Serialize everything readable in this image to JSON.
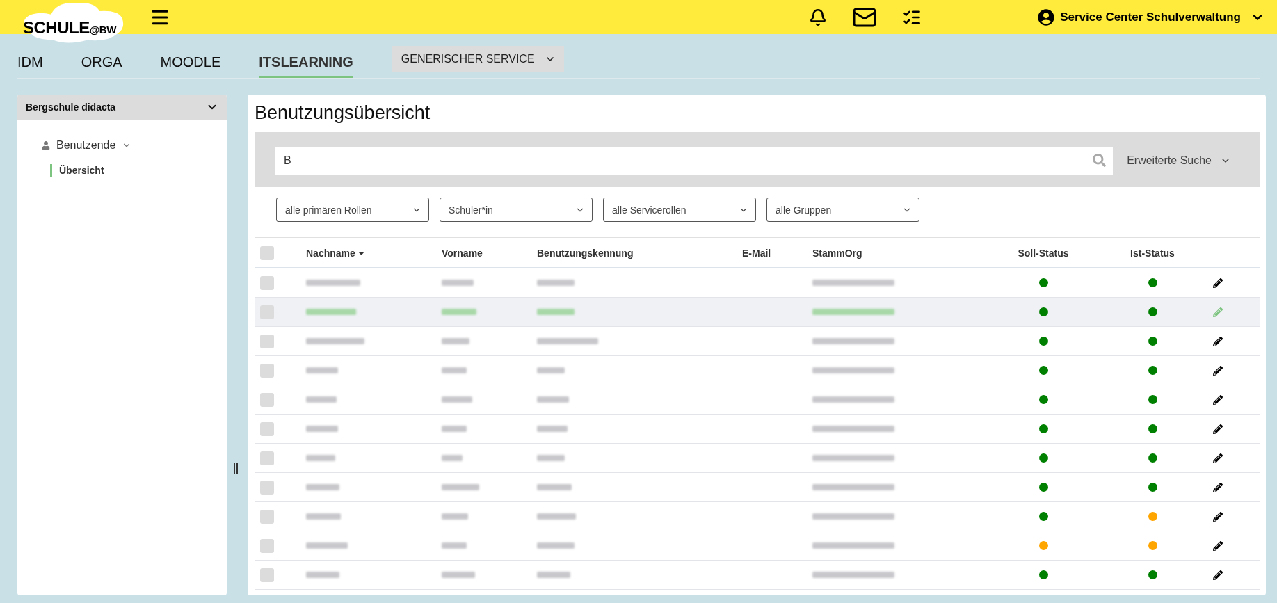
{
  "logo": {
    "main": "SCHULE",
    "suffix": "@BW"
  },
  "header": {
    "user": "Service Center Schulverwaltung"
  },
  "nav": {
    "tabs": [
      {
        "label": "IDM",
        "selected": false
      },
      {
        "label": "ORGA",
        "selected": false
      },
      {
        "label": "MOODLE",
        "selected": false
      },
      {
        "label": "ITSLEARNING",
        "selected": true
      }
    ],
    "service_dropdown": "GENERISCHER SERVICE"
  },
  "sidebar": {
    "school": "Bergschule didacta",
    "items": [
      {
        "label": "Benutzende",
        "expanded": true,
        "children": [
          {
            "label": "Übersicht",
            "selected": true
          }
        ]
      }
    ]
  },
  "main": {
    "title": "Benutzungsübersicht",
    "search": {
      "value": "B",
      "advanced": "Erweiterte Suche"
    },
    "filters": [
      "alle primären Rollen",
      "Schüler*in",
      "alle Servicerollen",
      "alle Gruppen"
    ],
    "table": {
      "select_all": {
        "checked": false
      },
      "columns": [
        {
          "label": "Nachname",
          "sorted": true
        },
        {
          "label": "Vorname",
          "sorted": false
        },
        {
          "label": "Benutzungskennung",
          "sorted": false
        },
        {
          "label": "E-Mail",
          "sorted": false
        },
        {
          "label": "StammOrg",
          "sorted": false
        },
        {
          "label": "Soll-Status",
          "sorted": false
        },
        {
          "label": "Ist-Status",
          "sorted": false
        }
      ],
      "rows": [
        {
          "checked": false,
          "highlighted": false,
          "soll": {
            "color": "#008000"
          },
          "ist": {
            "color": "#008000"
          }
        },
        {
          "checked": false,
          "highlighted": true,
          "soll": {
            "color": "#008000"
          },
          "ist": {
            "color": "#008000"
          }
        },
        {
          "checked": false,
          "highlighted": false,
          "soll": {
            "color": "#008000"
          },
          "ist": {
            "color": "#008000"
          }
        },
        {
          "checked": false,
          "highlighted": false,
          "soll": {
            "color": "#008000"
          },
          "ist": {
            "color": "#008000"
          }
        },
        {
          "checked": false,
          "highlighted": false,
          "soll": {
            "color": "#008000"
          },
          "ist": {
            "color": "#008000"
          }
        },
        {
          "checked": false,
          "highlighted": false,
          "soll": {
            "color": "#008000"
          },
          "ist": {
            "color": "#008000"
          }
        },
        {
          "checked": false,
          "highlighted": false,
          "soll": {
            "color": "#008000"
          },
          "ist": {
            "color": "#008000"
          }
        },
        {
          "checked": false,
          "highlighted": false,
          "soll": {
            "color": "#008000"
          },
          "ist": {
            "color": "#008000"
          }
        },
        {
          "checked": false,
          "highlighted": false,
          "soll": {
            "color": "#008000"
          },
          "ist": {
            "color": "#ffa500"
          }
        },
        {
          "checked": false,
          "highlighted": false,
          "soll": {
            "color": "#ffa500"
          },
          "ist": {
            "color": "#ffa500"
          }
        },
        {
          "checked": false,
          "highlighted": false,
          "soll": {
            "color": "#008000"
          },
          "ist": {
            "color": "#008000"
          }
        }
      ]
    }
  }
}
